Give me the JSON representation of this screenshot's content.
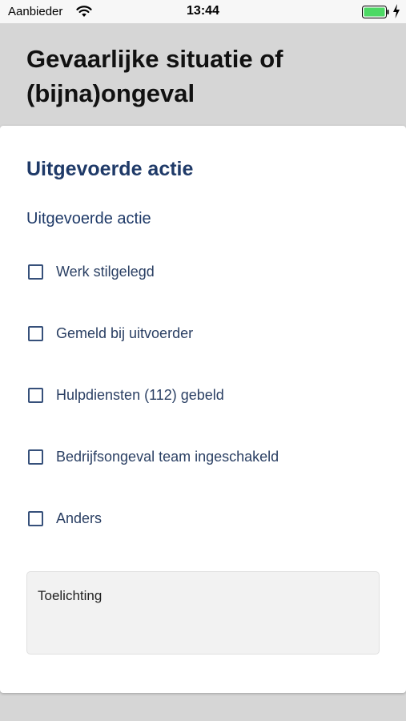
{
  "status_bar": {
    "carrier": "Aanbieder",
    "time": "13:44"
  },
  "header": {
    "title": "Gevaarlijke situatie of (bijna)ongeval"
  },
  "form": {
    "section_title": "Uitgevoerde actie",
    "field_label": "Uitgevoerde actie",
    "options": [
      {
        "label": "Werk stilgelegd",
        "checked": false
      },
      {
        "label": "Gemeld bij uitvoerder",
        "checked": false
      },
      {
        "label": "Hulpdiensten (112) gebeld",
        "checked": false
      },
      {
        "label": "Bedrijfsongeval team ingeschakeld",
        "checked": false
      },
      {
        "label": "Anders",
        "checked": false
      }
    ],
    "toelichting_placeholder": "Toelichting",
    "toelichting_value": ""
  },
  "colors": {
    "accent": "#1f3a68",
    "background": "#d6d6d6",
    "battery": "#4cd964"
  },
  "icons": {
    "wifi": "wifi-icon",
    "battery": "battery-icon",
    "charging": "charging-bolt-icon",
    "checkbox": "checkbox-unchecked-icon"
  }
}
